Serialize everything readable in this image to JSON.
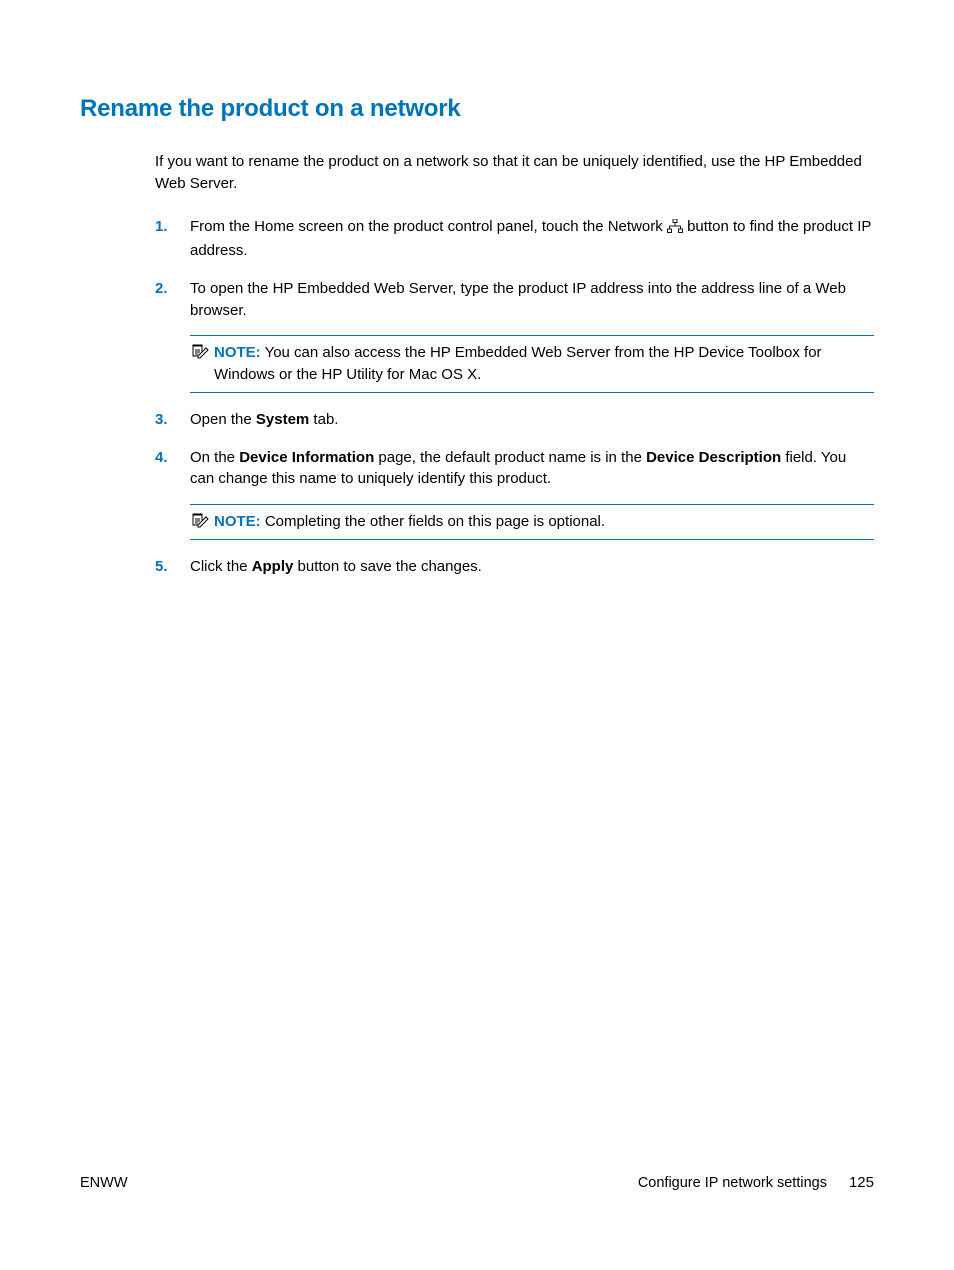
{
  "heading": "Rename the product on a network",
  "intro": "If you want to rename the product on a network so that it can be uniquely identified, use the HP Embedded Web Server.",
  "steps": {
    "s1": {
      "num": "1.",
      "text_before": "From the Home screen on the product control panel, touch the Network ",
      "text_after": " button to find the product IP address."
    },
    "s2": {
      "num": "2.",
      "text": "To open the HP Embedded Web Server, type the product IP address into the address line of a Web browser.",
      "note_label": "NOTE:",
      "note_text": " You can also access the HP Embedded Web Server from the HP Device Toolbox for Windows or the HP Utility for Mac OS X."
    },
    "s3": {
      "num": "3.",
      "text_before": "Open the ",
      "bold": "System",
      "text_after": " tab."
    },
    "s4": {
      "num": "4.",
      "text_before": "On the ",
      "bold1": "Device Information",
      "text_mid": " page, the default product name is in the ",
      "bold2": "Device Description",
      "text_after": " field. You can change this name to uniquely identify this product.",
      "note_label": "NOTE:",
      "note_text": " Completing the other fields on this page is optional."
    },
    "s5": {
      "num": "5.",
      "text_before": "Click the ",
      "bold": "Apply",
      "text_after": " button to save the changes."
    }
  },
  "footer": {
    "left": "ENWW",
    "section": "Configure IP network settings",
    "page": "125"
  }
}
